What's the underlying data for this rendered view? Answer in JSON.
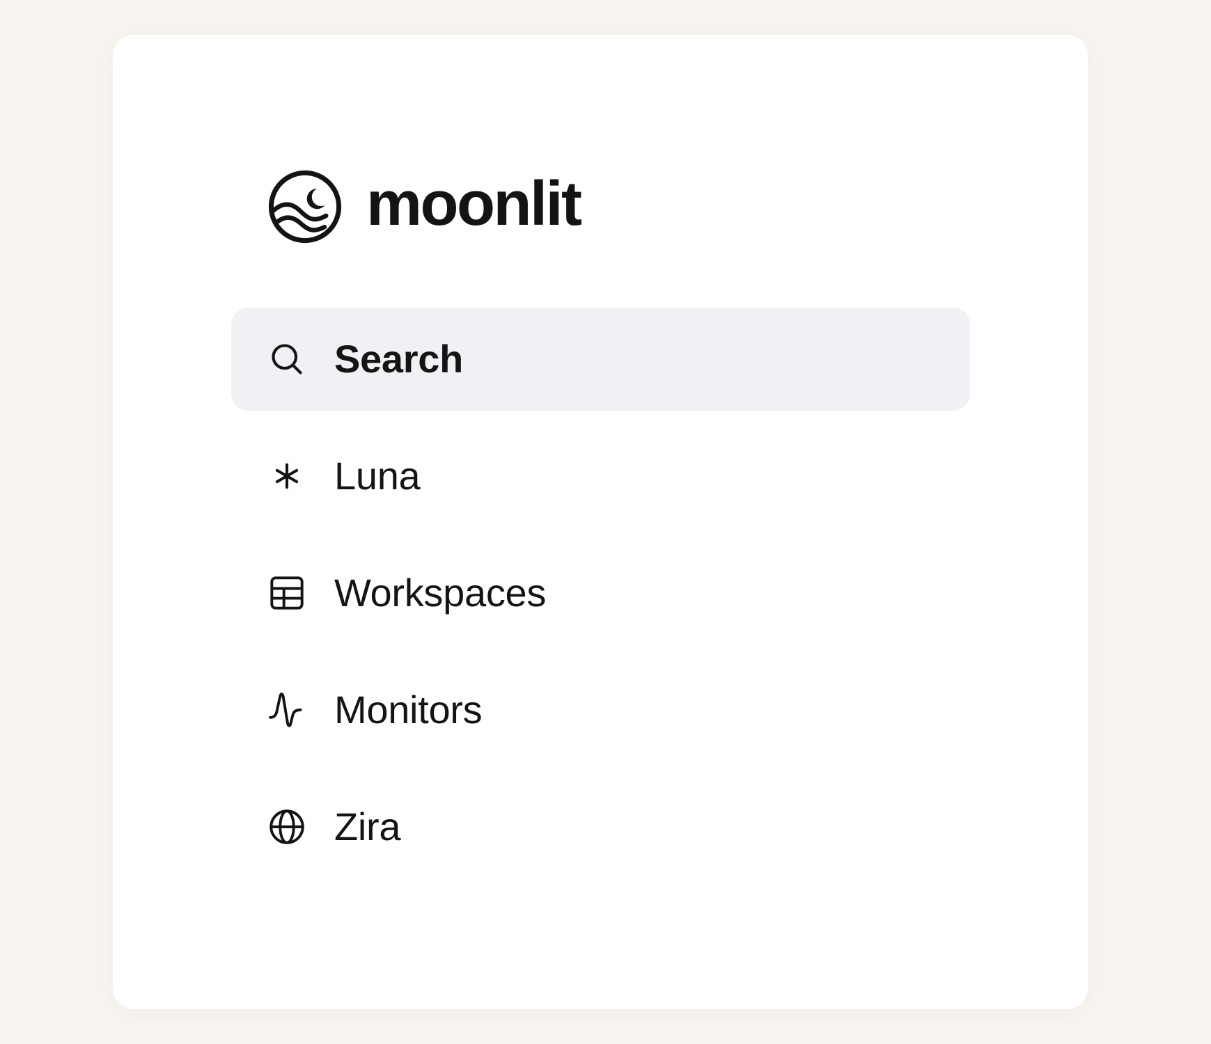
{
  "brand": {
    "name": "moonlit",
    "logo_icon": "moon-over-waves-logo"
  },
  "nav": {
    "items": [
      {
        "label": "Search",
        "icon": "search-icon",
        "active": true
      },
      {
        "label": "Luna",
        "icon": "asterisk-icon",
        "active": false
      },
      {
        "label": "Workspaces",
        "icon": "grid-table-icon",
        "active": false
      },
      {
        "label": "Monitors",
        "icon": "activity-pulse-icon",
        "active": false
      },
      {
        "label": "Zira",
        "icon": "globe-icon",
        "active": false
      }
    ]
  },
  "colors": {
    "page_background": "#f8f4f0",
    "card_background": "#ffffff",
    "active_item_background": "#f0f1f4",
    "text": "#141414"
  }
}
